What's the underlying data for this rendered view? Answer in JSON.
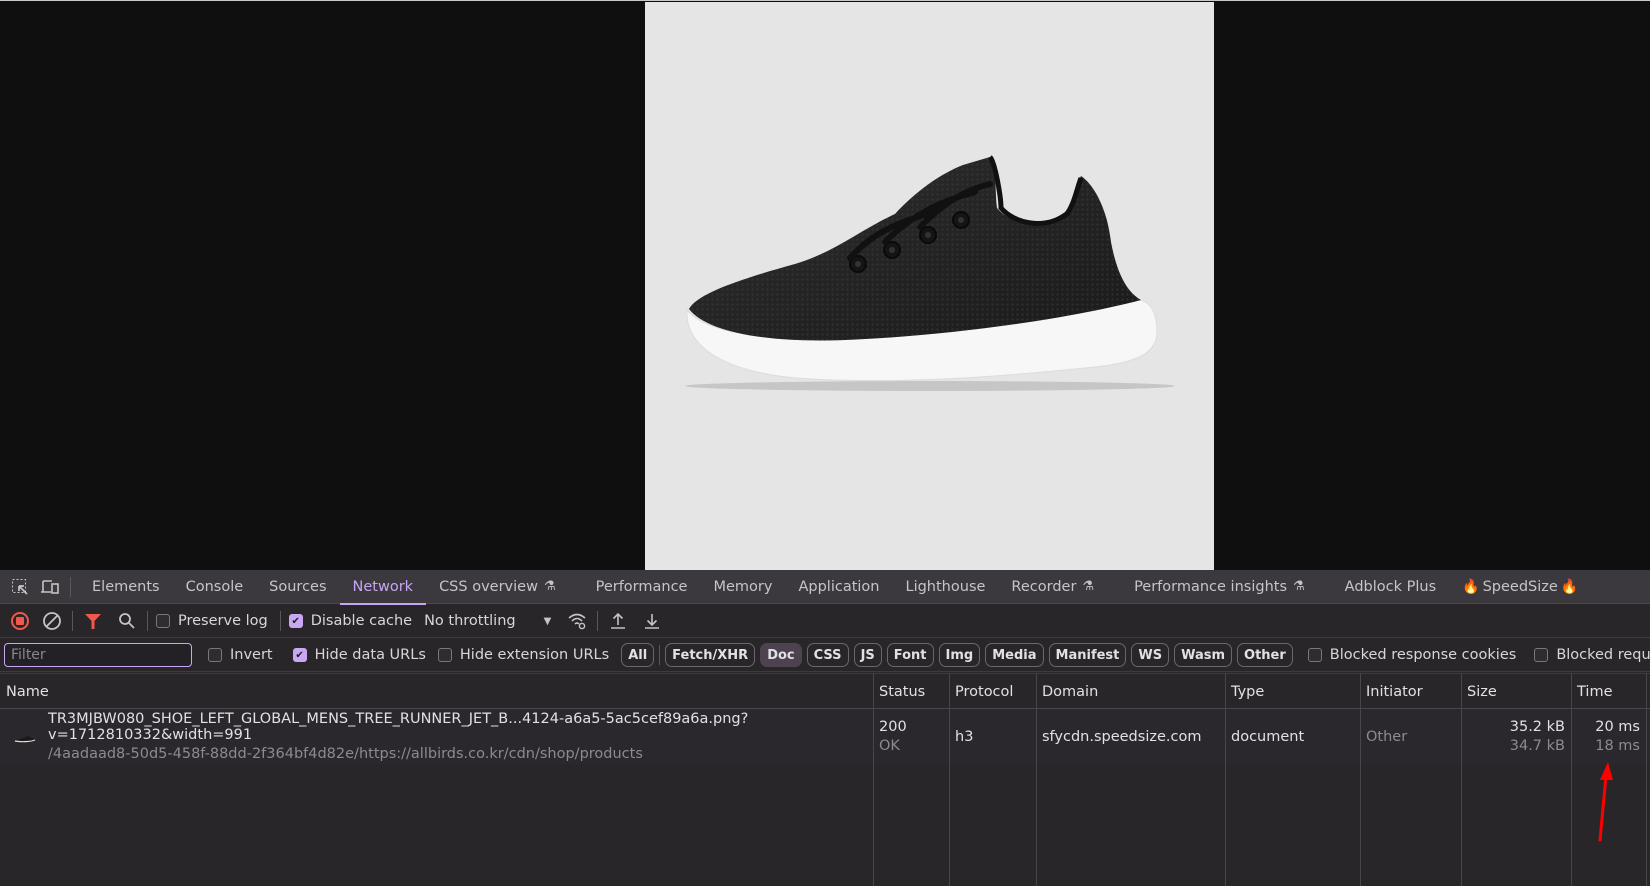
{
  "viewport": {
    "image_alt": "Black knit running shoe with white sole, side view"
  },
  "devtools": {
    "tabs": [
      {
        "label": "Elements",
        "active": false,
        "experimental": false
      },
      {
        "label": "Console",
        "active": false,
        "experimental": false
      },
      {
        "label": "Sources",
        "active": false,
        "experimental": false
      },
      {
        "label": "Network",
        "active": true,
        "experimental": false
      },
      {
        "label": "CSS overview",
        "active": false,
        "experimental": true
      },
      {
        "label": "Performance",
        "active": false,
        "experimental": false
      },
      {
        "label": "Memory",
        "active": false,
        "experimental": false
      },
      {
        "label": "Application",
        "active": false,
        "experimental": false
      },
      {
        "label": "Lighthouse",
        "active": false,
        "experimental": false
      },
      {
        "label": "Recorder",
        "active": false,
        "experimental": true
      },
      {
        "label": "Performance insights",
        "active": false,
        "experimental": true
      },
      {
        "label": "Adblock Plus",
        "active": false,
        "experimental": false
      },
      {
        "label": "SpeedSize",
        "active": false,
        "experimental": false,
        "emoji": "🔥"
      }
    ],
    "toolbar": {
      "record_icon": "stop-recording-icon",
      "clear_icon": "clear-icon",
      "filter_icon": "filter-icon",
      "search_icon": "search-icon",
      "preserve_log": {
        "label": "Preserve log",
        "checked": false
      },
      "disable_cache": {
        "label": "Disable cache",
        "checked": true
      },
      "throttling": "No throttling",
      "network_conditions_icon": "wifi-settings-icon",
      "import_icon": "upload-icon",
      "export_icon": "download-icon"
    },
    "filterbar": {
      "filter_placeholder": "Filter",
      "filter_value": "",
      "invert": {
        "label": "Invert",
        "checked": false
      },
      "hide_data_urls": {
        "label": "Hide data URLs",
        "checked": true
      },
      "hide_extension_urls": {
        "label": "Hide extension URLs",
        "checked": false
      },
      "type_filters": [
        {
          "label": "All",
          "active": false
        },
        {
          "label": "Fetch/XHR",
          "active": false
        },
        {
          "label": "Doc",
          "active": true
        },
        {
          "label": "CSS",
          "active": false
        },
        {
          "label": "JS",
          "active": false
        },
        {
          "label": "Font",
          "active": false
        },
        {
          "label": "Img",
          "active": false
        },
        {
          "label": "Media",
          "active": false
        },
        {
          "label": "Manifest",
          "active": false
        },
        {
          "label": "WS",
          "active": false
        },
        {
          "label": "Wasm",
          "active": false
        },
        {
          "label": "Other",
          "active": false
        }
      ],
      "blocked_response_cookies": {
        "label": "Blocked response cookies",
        "checked": false
      },
      "blocked_requests": {
        "label": "Blocked requests",
        "checked": false
      }
    },
    "table": {
      "columns": [
        "Name",
        "Status",
        "Protocol",
        "Domain",
        "Type",
        "Initiator",
        "Size",
        "Time"
      ],
      "rows": [
        {
          "name": "TR3MJBW080_SHOE_LEFT_GLOBAL_MENS_TREE_RUNNER_JET_B...4124-a6a5-5ac5cef89a6a.png?v=1712810332&width=991",
          "path": "/4aadaad8-50d5-458f-88dd-2f364bf4d82e/https://allbirds.co.kr/cdn/shop/products",
          "status_code": "200",
          "status_text": "OK",
          "protocol": "h3",
          "domain": "sfycdn.speedsize.com",
          "type": "document",
          "initiator": "Other",
          "size_transferred": "35.2 kB",
          "size_resource": "34.7 kB",
          "time_total": "20 ms",
          "time_latency": "18 ms"
        }
      ]
    }
  },
  "annotation": {
    "arrow_color": "#ff0000",
    "points_to": "18 ms"
  }
}
